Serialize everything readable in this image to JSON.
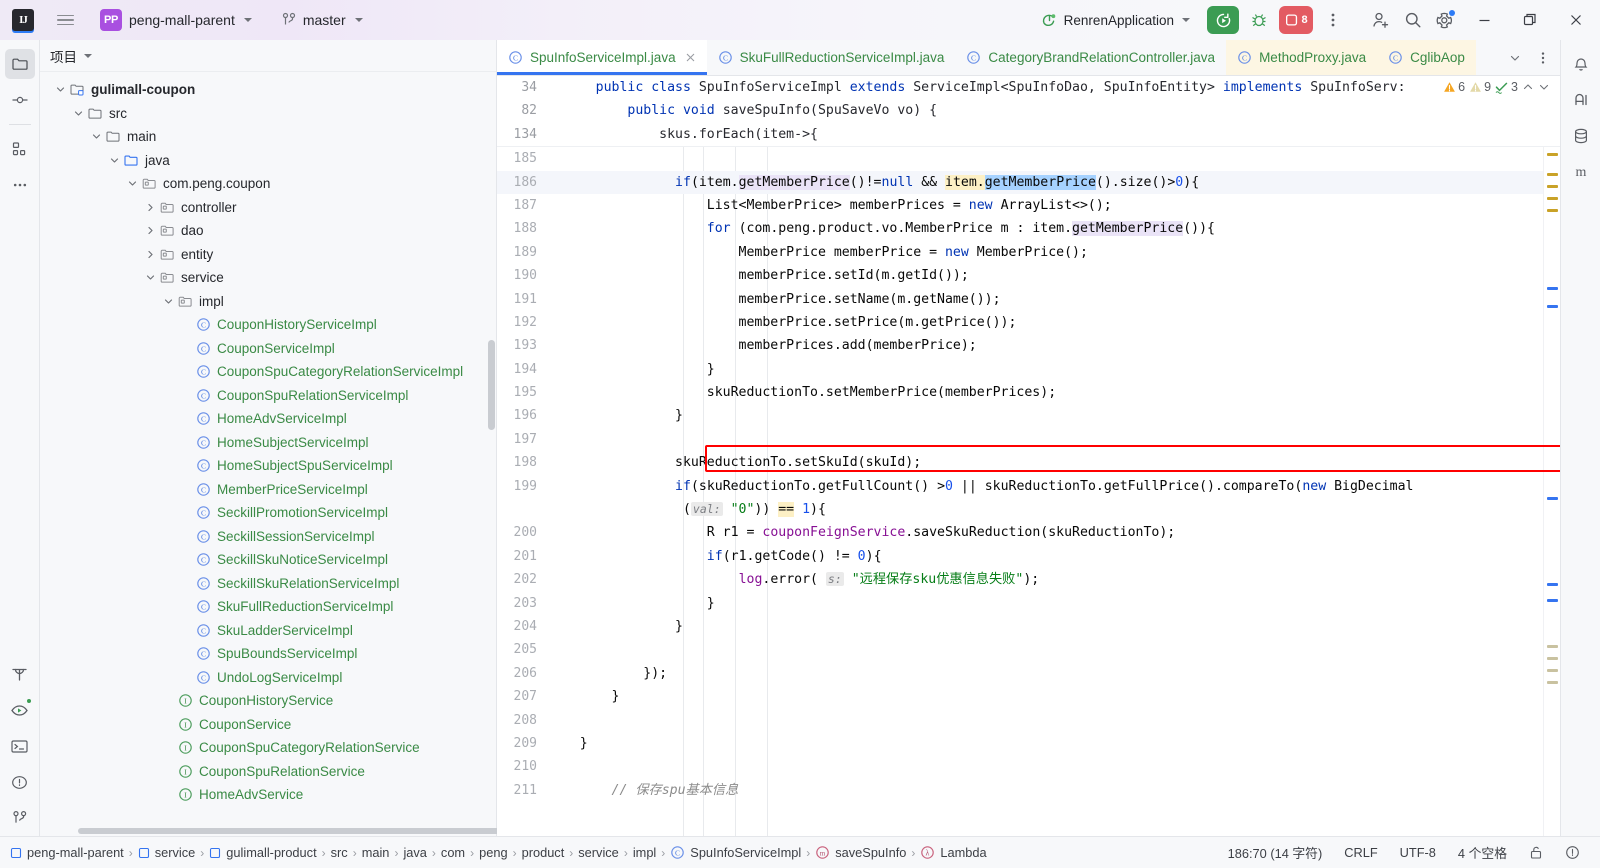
{
  "titlebar": {
    "logo_text": "IJ",
    "project_badge": "PP",
    "project_name": "peng-mall-parent",
    "branch_name": "master",
    "run_config": "RenrenApplication",
    "notification_count": "8"
  },
  "left_rail": [
    {
      "name": "project-tool-window",
      "icon": "folder-icon"
    },
    {
      "name": "commit-tool-window",
      "icon": "commit-icon"
    },
    {
      "name": "structure-tool-window",
      "icon": "structure-icon"
    },
    {
      "name": "more-tool-windows",
      "icon": "more-icon"
    },
    {
      "name": "build-tool-window",
      "icon": "hammer-icon"
    },
    {
      "name": "run-tool-window",
      "icon": "run-icon"
    },
    {
      "name": "terminal-tool-window",
      "icon": "terminal-icon"
    },
    {
      "name": "problems-tool-window",
      "icon": "problems-icon"
    },
    {
      "name": "version-control-tool-window",
      "icon": "branch-icon"
    }
  ],
  "project_panel": {
    "title": "项目",
    "tree": [
      {
        "label": "gulimall-coupon",
        "depth": 1,
        "arrow": "down",
        "icon": "module-icon",
        "style": "bold"
      },
      {
        "label": "src",
        "depth": 2,
        "arrow": "down",
        "icon": "folder-icon",
        "style": "normal"
      },
      {
        "label": "main",
        "depth": 3,
        "arrow": "down",
        "icon": "folder-icon",
        "style": "normal"
      },
      {
        "label": "java",
        "depth": 4,
        "arrow": "down",
        "icon": "source-folder-icon",
        "style": "normal"
      },
      {
        "label": "com.peng.coupon",
        "depth": 5,
        "arrow": "down",
        "icon": "package-icon",
        "style": "normal"
      },
      {
        "label": "controller",
        "depth": 6,
        "arrow": "right",
        "icon": "package-icon",
        "style": "normal"
      },
      {
        "label": "dao",
        "depth": 6,
        "arrow": "right",
        "icon": "package-icon",
        "style": "normal"
      },
      {
        "label": "entity",
        "depth": 6,
        "arrow": "right",
        "icon": "package-icon",
        "style": "normal"
      },
      {
        "label": "service",
        "depth": 6,
        "arrow": "down",
        "icon": "package-icon",
        "style": "normal"
      },
      {
        "label": "impl",
        "depth": 7,
        "arrow": "down",
        "icon": "package-icon",
        "style": "normal"
      },
      {
        "label": "CouponHistoryServiceImpl",
        "depth": 8,
        "arrow": "none",
        "icon": "class-icon",
        "style": "green"
      },
      {
        "label": "CouponServiceImpl",
        "depth": 8,
        "arrow": "none",
        "icon": "class-icon",
        "style": "green"
      },
      {
        "label": "CouponSpuCategoryRelationServiceImpl",
        "depth": 8,
        "arrow": "none",
        "icon": "class-icon",
        "style": "green"
      },
      {
        "label": "CouponSpuRelationServiceImpl",
        "depth": 8,
        "arrow": "none",
        "icon": "class-icon",
        "style": "green"
      },
      {
        "label": "HomeAdvServiceImpl",
        "depth": 8,
        "arrow": "none",
        "icon": "class-icon",
        "style": "green"
      },
      {
        "label": "HomeSubjectServiceImpl",
        "depth": 8,
        "arrow": "none",
        "icon": "class-icon",
        "style": "green"
      },
      {
        "label": "HomeSubjectSpuServiceImpl",
        "depth": 8,
        "arrow": "none",
        "icon": "class-icon",
        "style": "green"
      },
      {
        "label": "MemberPriceServiceImpl",
        "depth": 8,
        "arrow": "none",
        "icon": "class-icon",
        "style": "green"
      },
      {
        "label": "SeckillPromotionServiceImpl",
        "depth": 8,
        "arrow": "none",
        "icon": "class-icon",
        "style": "green"
      },
      {
        "label": "SeckillSessionServiceImpl",
        "depth": 8,
        "arrow": "none",
        "icon": "class-icon",
        "style": "green"
      },
      {
        "label": "SeckillSkuNoticeServiceImpl",
        "depth": 8,
        "arrow": "none",
        "icon": "class-icon",
        "style": "green"
      },
      {
        "label": "SeckillSkuRelationServiceImpl",
        "depth": 8,
        "arrow": "none",
        "icon": "class-icon",
        "style": "green"
      },
      {
        "label": "SkuFullReductionServiceImpl",
        "depth": 8,
        "arrow": "none",
        "icon": "class-icon",
        "style": "green"
      },
      {
        "label": "SkuLadderServiceImpl",
        "depth": 8,
        "arrow": "none",
        "icon": "class-icon",
        "style": "green"
      },
      {
        "label": "SpuBoundsServiceImpl",
        "depth": 8,
        "arrow": "none",
        "icon": "class-icon",
        "style": "green"
      },
      {
        "label": "UndoLogServiceImpl",
        "depth": 8,
        "arrow": "none",
        "icon": "class-icon",
        "style": "green"
      },
      {
        "label": "CouponHistoryService",
        "depth": 7,
        "arrow": "none",
        "icon": "interface-icon",
        "style": "green"
      },
      {
        "label": "CouponService",
        "depth": 7,
        "arrow": "none",
        "icon": "interface-icon",
        "style": "green"
      },
      {
        "label": "CouponSpuCategoryRelationService",
        "depth": 7,
        "arrow": "none",
        "icon": "interface-icon",
        "style": "green"
      },
      {
        "label": "CouponSpuRelationService",
        "depth": 7,
        "arrow": "none",
        "icon": "interface-icon",
        "style": "green"
      },
      {
        "label": "HomeAdvService",
        "depth": 7,
        "arrow": "none",
        "icon": "interface-icon",
        "style": "green"
      }
    ]
  },
  "tabs": [
    {
      "label": "SpuInfoServiceImpl.java",
      "active": true,
      "pinned": false,
      "closable": true
    },
    {
      "label": "SkuFullReductionServiceImpl.java",
      "active": false,
      "pinned": false,
      "closable": false
    },
    {
      "label": "CategoryBrandRelationController.java",
      "active": false,
      "pinned": false,
      "closable": false
    },
    {
      "label": "MethodProxy.java",
      "active": false,
      "pinned": true,
      "closable": false
    },
    {
      "label": "CglibAop",
      "active": false,
      "pinned": true,
      "closable": false
    }
  ],
  "inspections": {
    "errors": "6",
    "warnings": "9",
    "ok": "3"
  },
  "sticky_lines": [
    {
      "num": "34",
      "html": "      <span class='kw'>public class</span> SpuInfoServiceImpl <span class='kw'>extends</span> ServiceImpl&lt;SpuInfoDao, SpuInfoEntity&gt; <span class='kw'>implements</span> SpuInfoServ:"
    },
    {
      "num": "82",
      "html": "          <span class='kw'>public void</span> saveSpuInfo(SpuSaveVo vo) {"
    },
    {
      "num": "134",
      "html": "              skus.forEach(item-&gt;{"
    }
  ],
  "code_lines": [
    {
      "num": "185",
      "html": "",
      "current": false
    },
    {
      "num": "186",
      "html": "                <span class='kw'>if</span>(item.<span class='hl-ident'>getMemberPrice</span>()!=<span class='kw'>null</span> &amp;&amp; <span class='hl-usage'>item.</span><span class='hl-sel'>getMemberPrice</span>().size()&gt;<span class='num'>0</span>){",
      "current": true
    },
    {
      "num": "187",
      "html": "                    List&lt;MemberPrice&gt; memberPrices = <span class='kw'>new</span> ArrayList&lt;&gt;();",
      "current": false
    },
    {
      "num": "188",
      "html": "                    <span class='kw'>for</span> (com.peng.product.vo.MemberPrice m : item.<span class='hl-ident'>getMemberPrice</span>()){",
      "current": false
    },
    {
      "num": "189",
      "html": "                        MemberPrice memberPrice = <span class='kw'>new</span> MemberPrice();",
      "current": false
    },
    {
      "num": "190",
      "html": "                        memberPrice.setId(m.getId());",
      "current": false
    },
    {
      "num": "191",
      "html": "                        memberPrice.setName(m.getName());",
      "current": false
    },
    {
      "num": "192",
      "html": "                        memberPrice.setPrice(m.getPrice());",
      "current": false
    },
    {
      "num": "193",
      "html": "                        memberPrices.add(memberPrice);",
      "current": false
    },
    {
      "num": "194",
      "html": "                    }",
      "current": false
    },
    {
      "num": "195",
      "html": "                    skuReductionTo.setMemberPrice(memberPrices);",
      "current": false
    },
    {
      "num": "196",
      "html": "                }",
      "current": false
    },
    {
      "num": "197",
      "html": "",
      "current": false
    },
    {
      "num": "198",
      "html": "                skuReductionTo.setSkuId(skuId);",
      "current": false
    },
    {
      "num": "199",
      "html": "                <span class='kw'>if</span>(skuReductionTo.getFullCount() &gt;<span class='num'>0</span> || skuReductionTo.getFullPrice().compareTo(<span class='kw'>new</span> BigDecimal",
      "current": false
    },
    {
      "num": "",
      "html": "                 (<span class='hint'>val:</span> <span class='str'>\"0\"</span>)) <span class='hl-usage'>==</span> <span class='num'>1</span>){",
      "current": false
    },
    {
      "num": "200",
      "html": "                    R r1 = <span class='fld'>couponFeignService</span>.saveSkuReduction(skuReductionTo);",
      "current": false
    },
    {
      "num": "201",
      "html": "                    <span class='kw'>if</span>(r1.getCode() != <span class='num'>0</span>){",
      "current": false
    },
    {
      "num": "202",
      "html": "                        <span class='fld'>log</span>.error( <span class='hint'>s:</span> <span class='str'>\"远程保存sku优惠信息失败\"</span>);",
      "current": false
    },
    {
      "num": "203",
      "html": "                    }",
      "current": false
    },
    {
      "num": "204",
      "html": "                }",
      "current": false
    },
    {
      "num": "205",
      "html": "",
      "current": false
    },
    {
      "num": "206",
      "html": "            });",
      "current": false
    },
    {
      "num": "207",
      "html": "        }",
      "current": false
    },
    {
      "num": "208",
      "html": "",
      "current": false
    },
    {
      "num": "209",
      "html": "    }",
      "current": false
    },
    {
      "num": "210",
      "html": "",
      "current": false
    },
    {
      "num": "211",
      "html": "        <span class='cmt'>// 保存spu基本信息</span>",
      "current": false
    }
  ],
  "statusbar": {
    "breadcrumbs": [
      {
        "label": "peng-mall-parent",
        "icon": "module-icon"
      },
      {
        "label": "service",
        "icon": "module-icon"
      },
      {
        "label": "gulimall-product",
        "icon": "module-icon"
      },
      {
        "label": "src",
        "icon": "none"
      },
      {
        "label": "main",
        "icon": "none"
      },
      {
        "label": "java",
        "icon": "none"
      },
      {
        "label": "com",
        "icon": "none"
      },
      {
        "label": "peng",
        "icon": "none"
      },
      {
        "label": "product",
        "icon": "none"
      },
      {
        "label": "service",
        "icon": "none"
      },
      {
        "label": "impl",
        "icon": "none"
      },
      {
        "label": "SpuInfoServiceImpl",
        "icon": "class-icon"
      },
      {
        "label": "saveSpuInfo",
        "icon": "method-icon"
      },
      {
        "label": "Lambda",
        "icon": "lambda-icon"
      }
    ],
    "caret": "186:70 (14 字符)",
    "line_sep": "CRLF",
    "encoding": "UTF-8",
    "indent": "4 个空格"
  },
  "colors": {
    "accent_blue": "#3574F0",
    "green": "#3B9C53",
    "red": "#E35B62",
    "purple": "#A94FE0",
    "highlight_box": "#FF0000"
  }
}
